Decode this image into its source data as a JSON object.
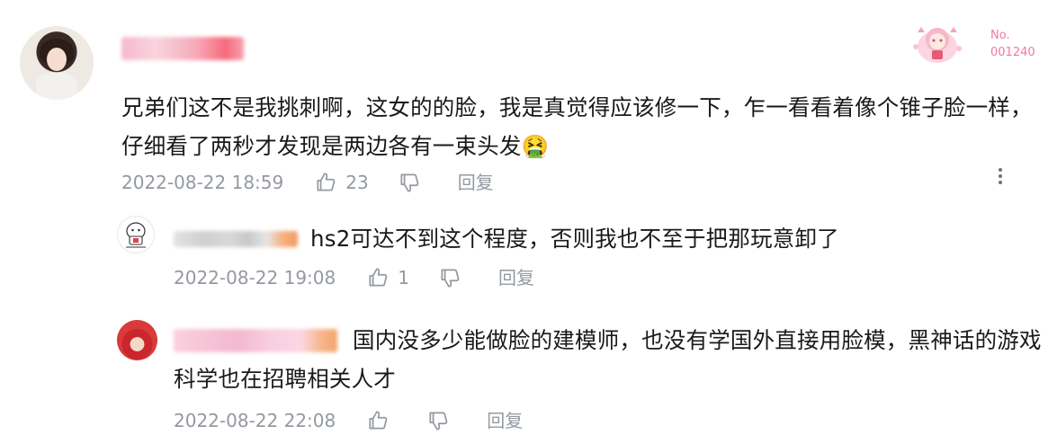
{
  "main_comment": {
    "username": "",
    "text": "兄弟们这不是我挑刺啊，这女的的脸，我是真觉得应该修一下，乍一看看着像个锥子脸一样，仔细看了两秒才发现是两边各有一束头发🤮",
    "time": "2022-08-22 18:59",
    "like_count": "23",
    "reply_label": "回复",
    "badge": {
      "line1": "No.",
      "line2": "001240"
    }
  },
  "replies": [
    {
      "username": "",
      "text": "hs2可达不到这个程度，否则我也不至于把那玩意卸了",
      "time": "2022-08-22 19:08",
      "like_count": "1",
      "reply_label": "回复"
    },
    {
      "username": "",
      "text": "国内没多少能做脸的建模师，也没有学国外直接用脸模，黑神话的游戏科学也在招聘相关人才",
      "time": "2022-08-22 22:08",
      "like_count": "",
      "reply_label": "回复"
    }
  ],
  "colors": {
    "text": "#18191c",
    "meta": "#9499a0",
    "badge": "#f07a9a"
  }
}
